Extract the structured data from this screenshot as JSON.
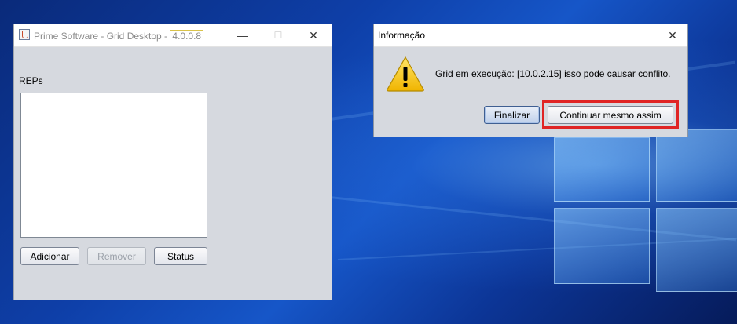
{
  "main_window": {
    "title_prefix": "Prime Software - Grid Desktop - ",
    "version": "4.0.0.8",
    "minimize_glyph": "—",
    "maximize_glyph": "☐",
    "close_glyph": "✕",
    "list_label": "REPs",
    "buttons": {
      "add": "Adicionar",
      "remove": "Remover",
      "status": "Status"
    }
  },
  "dialog": {
    "title": "Informação",
    "close_glyph": "✕",
    "message": "Grid em execução: [10.0.2.15] isso pode causar conflito.",
    "icon": "warning-icon",
    "buttons": {
      "finish": "Finalizar",
      "continue": "Continuar mesmo assim"
    }
  },
  "colors": {
    "highlight": "#e02424",
    "warning_yellow": "#f5c400"
  }
}
